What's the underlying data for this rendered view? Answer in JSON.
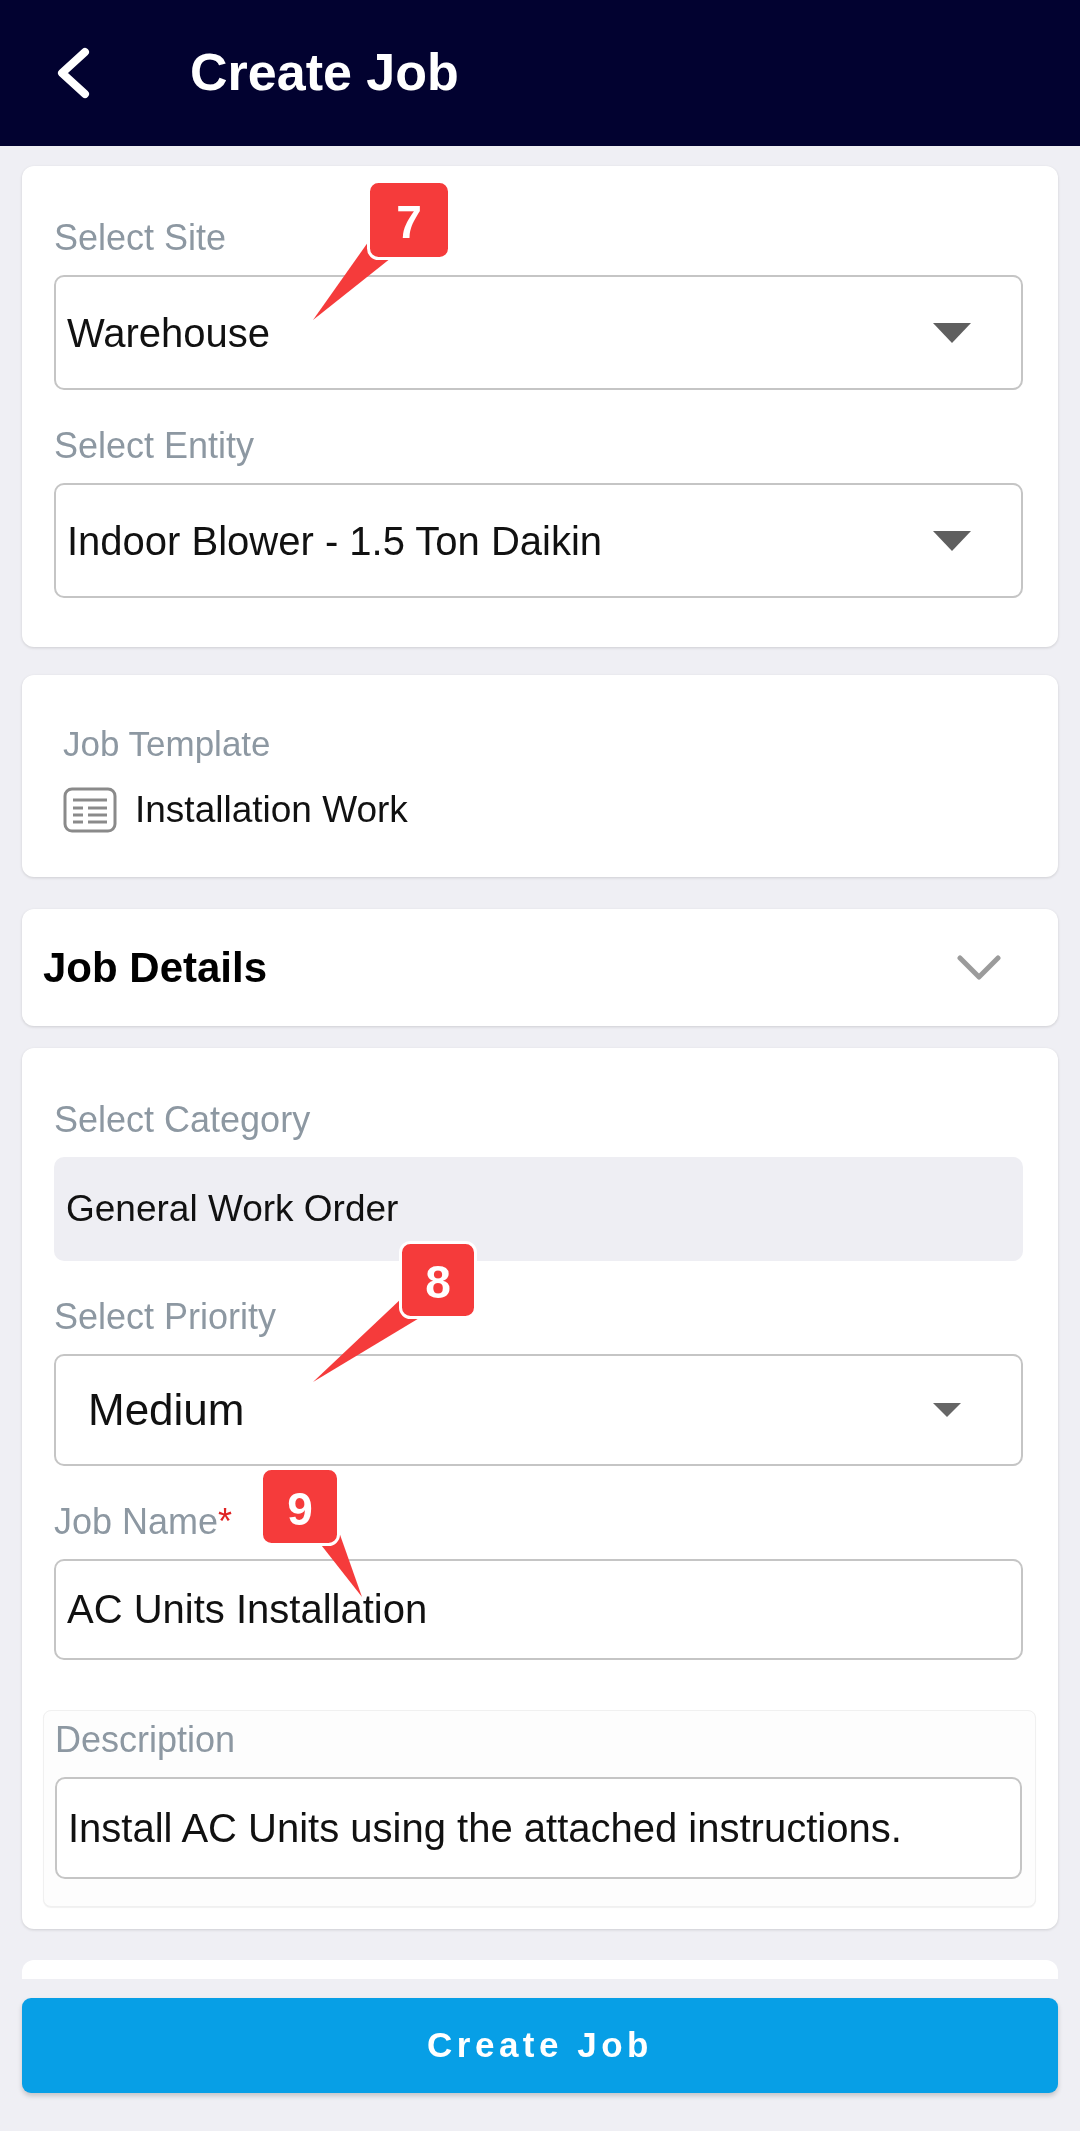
{
  "header": {
    "title": "Create Job"
  },
  "site_card": {
    "fields": [
      {
        "label": "Select Site",
        "value": "Warehouse",
        "kind": "select"
      },
      {
        "label": "Select Entity",
        "value": "Indoor Blower - 1.5 Ton Daikin",
        "kind": "select"
      }
    ]
  },
  "template_card": {
    "label": "Job Template",
    "value": "Installation Work"
  },
  "job_details": {
    "title": "Job Details"
  },
  "details_card": {
    "fields": [
      {
        "label": "Select Category",
        "value": "General Work Order",
        "kind": "readonly"
      },
      {
        "label": "Select Priority",
        "value": "Medium",
        "kind": "picker"
      },
      {
        "label": "Job Name",
        "required_mark": "*",
        "value": "AC Units Installation",
        "kind": "text"
      },
      {
        "label": "Description",
        "value": "Install AC Units using the attached instructions.",
        "kind": "textarea"
      }
    ]
  },
  "footer": {
    "button": "Create Job"
  },
  "callouts": [
    {
      "number": "7"
    },
    {
      "number": "8"
    },
    {
      "number": "9"
    }
  ]
}
